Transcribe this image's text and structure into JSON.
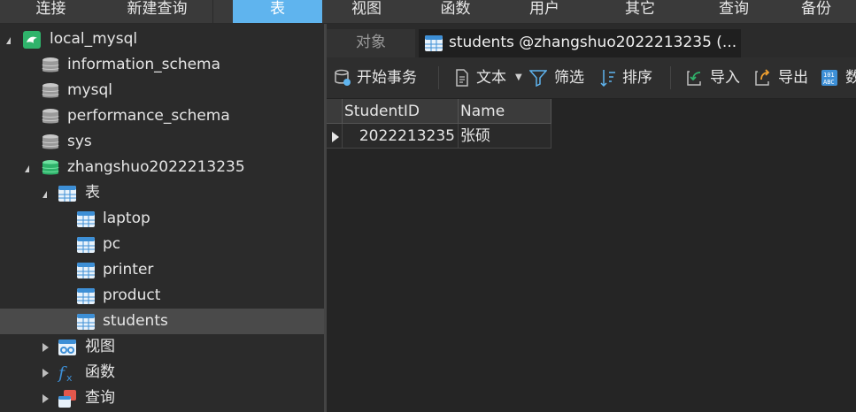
{
  "menu": {
    "items": [
      "连接",
      "新建查询",
      "表",
      "视图",
      "函数",
      "用户",
      "其它",
      "查询",
      "备份"
    ],
    "active_index": 2
  },
  "sidebar": {
    "connection": {
      "label": "local_mysql",
      "icon": "mysql-connection-icon"
    },
    "databases": [
      {
        "label": "information_schema",
        "icon": "database-icon"
      },
      {
        "label": "mysql",
        "icon": "database-icon"
      },
      {
        "label": "performance_schema",
        "icon": "database-icon"
      },
      {
        "label": "sys",
        "icon": "database-icon"
      },
      {
        "label": "zhangshuo2022213235",
        "icon": "database-open-icon"
      }
    ],
    "groups": {
      "tables": {
        "label": "表",
        "icon": "table-folder-icon"
      },
      "views": {
        "label": "视图",
        "icon": "view-folder-icon"
      },
      "functions": {
        "label": "函数",
        "icon": "function-folder-icon"
      },
      "queries": {
        "label": "查询",
        "icon": "query-folder-icon"
      }
    },
    "tables": [
      {
        "label": "laptop",
        "icon": "table-icon"
      },
      {
        "label": "pc",
        "icon": "table-icon"
      },
      {
        "label": "printer",
        "icon": "table-icon"
      },
      {
        "label": "product",
        "icon": "table-icon"
      },
      {
        "label": "students",
        "icon": "table-icon",
        "selected": true
      }
    ]
  },
  "tabs": {
    "objects": "对象",
    "current": "students @zhangshuo2022213235 (..."
  },
  "toolbar": {
    "begin_transaction": "开始事务",
    "text": "文本",
    "filter": "筛选",
    "sort": "排序",
    "import": "导入",
    "export": "导出",
    "data": "数"
  },
  "grid": {
    "columns": [
      "StudentID",
      "Name"
    ],
    "rows": [
      [
        "2022213235",
        "张硕"
      ]
    ]
  },
  "colors": {
    "menu_active": "#5fb4ee",
    "accent_blue": "#3d8fd6",
    "db_green": "#2fb36b"
  }
}
